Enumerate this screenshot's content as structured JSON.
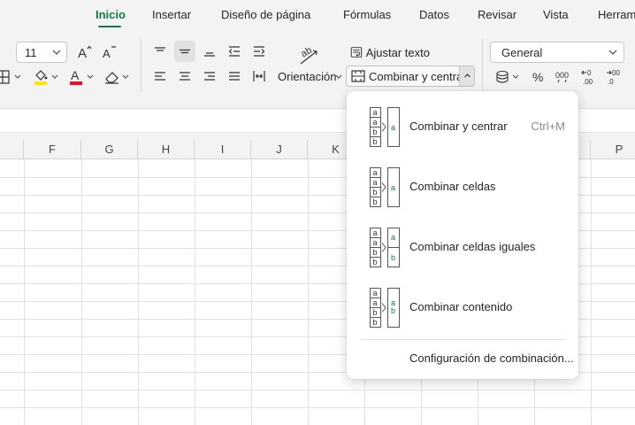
{
  "tabs": [
    {
      "label": "Inicio",
      "active": true
    },
    {
      "label": "Insertar"
    },
    {
      "label": "Diseño de página"
    },
    {
      "label": "Fórmulas"
    },
    {
      "label": "Datos"
    },
    {
      "label": "Revisar"
    },
    {
      "label": "Vista"
    },
    {
      "label": "Herram"
    }
  ],
  "ribbon": {
    "font_size": "11",
    "wrap_text_label": "Ajustar texto",
    "orientation_label": "Orientación",
    "merge_label": "Combinar y centrar",
    "number_format": "General",
    "font_color": "#e81123",
    "fill_color": "#ffe600"
  },
  "columns": [
    "F",
    "G",
    "H",
    "I",
    "J",
    "K",
    "P"
  ],
  "merge_menu": {
    "items": [
      {
        "label": "Combinar y centrar",
        "shortcut": "Ctrl+M",
        "icon": "merge-center-icon"
      },
      {
        "label": "Combinar celdas",
        "icon": "merge-cells-icon"
      },
      {
        "label": "Combinar celdas iguales",
        "icon": "merge-same-icon"
      },
      {
        "label": "Combinar contenido",
        "icon": "merge-content-icon"
      }
    ],
    "settings_label": "Configuración de combinación..."
  },
  "colors": {
    "accent": "#107c41",
    "icon_green": "#107c41"
  }
}
